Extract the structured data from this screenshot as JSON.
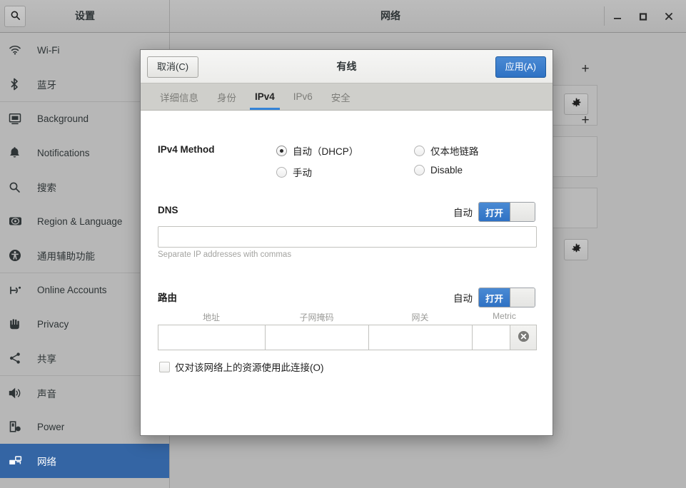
{
  "window": {
    "settings_title": "设置",
    "network_title": "网络",
    "search_icon": "search-icon",
    "controls": {
      "minimize": "minimize-icon",
      "maximize": "maximize-icon",
      "close": "close-icon"
    }
  },
  "sidebar": {
    "items": [
      {
        "label": "Wi-Fi",
        "icon": "wifi-icon",
        "selected": false,
        "separator_above": false
      },
      {
        "label": "蓝牙",
        "icon": "bluetooth-icon",
        "selected": false,
        "separator_above": false
      },
      {
        "label": "Background",
        "icon": "background-icon",
        "selected": false,
        "separator_above": true
      },
      {
        "label": "Notifications",
        "icon": "bell-icon",
        "selected": false,
        "separator_above": false
      },
      {
        "label": "搜索",
        "icon": "search-icon",
        "selected": false,
        "separator_above": false
      },
      {
        "label": "Region & Language",
        "icon": "globe-icon",
        "selected": false,
        "separator_above": false
      },
      {
        "label": "通用辅助功能",
        "icon": "accessibility-icon",
        "selected": false,
        "separator_above": false
      },
      {
        "label": "Online Accounts",
        "icon": "online-accounts-icon",
        "selected": false,
        "separator_above": true
      },
      {
        "label": "Privacy",
        "icon": "privacy-hand-icon",
        "selected": false,
        "separator_above": false
      },
      {
        "label": "共享",
        "icon": "share-icon",
        "selected": false,
        "separator_above": false
      },
      {
        "label": "声音",
        "icon": "sound-icon",
        "selected": false,
        "separator_above": true
      },
      {
        "label": "Power",
        "icon": "power-icon",
        "selected": false,
        "separator_above": false
      },
      {
        "label": "网络",
        "icon": "network-icon",
        "selected": true,
        "separator_above": false
      }
    ],
    "selected_color": "#3465a4"
  },
  "netpanel": {
    "add_label": "+",
    "gear_icon": "gear-icon"
  },
  "dialog": {
    "title": "有线",
    "cancel_label": "取消(C)",
    "apply_label": "应用(A)",
    "accent_color": "#3584d8",
    "tabs": [
      {
        "label": "详细信息",
        "active": false
      },
      {
        "label": "身份",
        "active": false
      },
      {
        "label": "IPv4",
        "active": true
      },
      {
        "label": "IPv6",
        "active": false
      },
      {
        "label": "安全",
        "active": false
      }
    ],
    "method": {
      "label": "IPv4 Method",
      "options": [
        {
          "label": "自动（DHCP）",
          "checked": true
        },
        {
          "label": "手动",
          "checked": false
        },
        {
          "label": "仅本地链路",
          "checked": false
        },
        {
          "label": "Disable",
          "checked": false
        }
      ]
    },
    "dns": {
      "label": "DNS",
      "auto_label": "自动",
      "toggle_on_label": "打开",
      "toggle_state": "on",
      "value": "",
      "hint": "Separate IP addresses with commas"
    },
    "routes": {
      "label": "路由",
      "auto_label": "自动",
      "toggle_on_label": "打开",
      "toggle_state": "on",
      "columns": [
        "地址",
        "子网掩码",
        "网关",
        "Metric"
      ],
      "rows": [
        {
          "address": "",
          "netmask": "",
          "gateway": "",
          "metric": ""
        }
      ],
      "delete_icon": "remove-circle-icon"
    },
    "restrict": {
      "label": "仅对该网络上的资源使用此连接(O)",
      "checked": false
    }
  }
}
